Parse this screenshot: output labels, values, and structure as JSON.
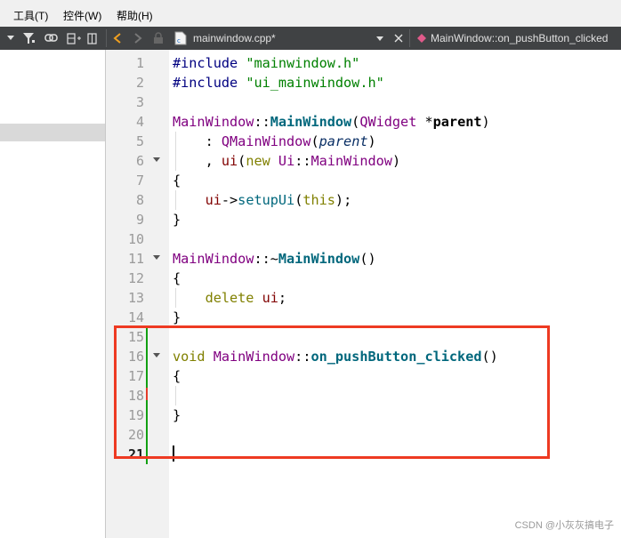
{
  "menu": {
    "items": [
      "工具(T)",
      "控件(W)",
      "帮助(H)"
    ]
  },
  "editor_toolbar": {
    "file_name": "mainwindow.cpp*",
    "symbol_name": "MainWindow::on_pushButton_clicked",
    "icons": [
      "dropdown-arrow-icon",
      "filter-icon",
      "link-icon",
      "split-horizontal-icon",
      "split-vertical-icon",
      "back-icon",
      "forward-icon",
      "lock-icon",
      "cpp-file-icon",
      "combo-dropdown-icon",
      "close-icon",
      "function-diamond-icon"
    ]
  },
  "line_numbers": [
    "1",
    "2",
    "3",
    "4",
    "5",
    "6",
    "7",
    "8",
    "9",
    "10",
    "11",
    "12",
    "13",
    "14",
    "15",
    "16",
    "17",
    "18",
    "19",
    "20",
    "21"
  ],
  "code": {
    "l1": [
      "#include",
      " ",
      "\"mainwindow.h\""
    ],
    "l2": [
      "#include",
      " ",
      "\"ui_mainwindow.h\""
    ],
    "l4": [
      "MainWindow",
      "::",
      "MainWindow",
      "(",
      "QWidget",
      " *",
      "parent",
      ")"
    ],
    "l5": [
      "    : ",
      "QMainWindow",
      "(",
      "parent",
      ")"
    ],
    "l6": [
      "    , ",
      "ui",
      "(",
      "new",
      " ",
      "Ui",
      "::",
      "MainWindow",
      ")"
    ],
    "l7": "{",
    "l8": [
      "    ",
      "ui",
      "->",
      "setupUi",
      "(",
      "this",
      ");"
    ],
    "l9": "}",
    "l11": [
      "MainWindow",
      "::~",
      "MainWindow",
      "()"
    ],
    "l12": "{",
    "l13": [
      "    ",
      "delete",
      " ",
      "ui",
      ";"
    ],
    "l14": "}",
    "l16": [
      "void",
      " ",
      "MainWindow",
      "::",
      "on_pushButton_clicked",
      "()"
    ],
    "l17": "{",
    "l19": "}"
  },
  "current_line": "21",
  "watermark": "CSDN @小灰灰搞电子",
  "colors": {
    "highlight_box": "#ee3a22",
    "change_bar": "#12a012",
    "toolbar_bg": "#404244"
  }
}
